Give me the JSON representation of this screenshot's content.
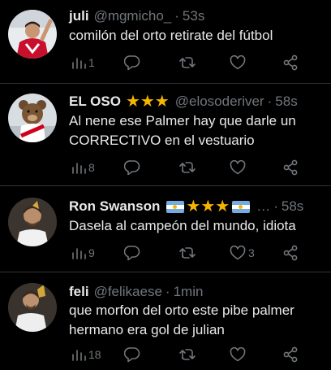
{
  "tweets": [
    {
      "name": "juli",
      "handle": "@mgmicho_",
      "dot": "·",
      "time": "53s",
      "text": "comilón del orto retirate del fútbol",
      "views": "1",
      "likes": ""
    },
    {
      "name": "EL OSO",
      "badges": "★★★",
      "handle": "@elosoderiver",
      "dot": "·",
      "time": "58s",
      "text_line1": "Al nene ese Palmer hay que darle un",
      "text_line2": "CORRECTIVO en el vestuario",
      "views": "8",
      "likes": ""
    },
    {
      "name": "Ron Swanson",
      "badges": "★★★",
      "ellipsis": "…",
      "dot": "·",
      "time": "58s",
      "text": "Dasela al campeón del mundo, idiota",
      "views": "9",
      "likes": "3"
    },
    {
      "name": "feli",
      "handle": "@felikaese",
      "dot": "·",
      "time": "1min",
      "text_line1": "que morfon del orto este pibe palmer",
      "text_line2": "hermano era gol de julian",
      "views": "18",
      "likes": ""
    }
  ],
  "colors": {
    "background": "#000000",
    "text": "#e7e9ea",
    "muted": "#71767b",
    "star": "#f5b400",
    "divider": "#2f3336"
  },
  "icons": [
    "views-icon",
    "reply-icon",
    "retweet-icon",
    "like-icon",
    "share-icon",
    "star-icon",
    "argentina-flag-icon"
  ]
}
